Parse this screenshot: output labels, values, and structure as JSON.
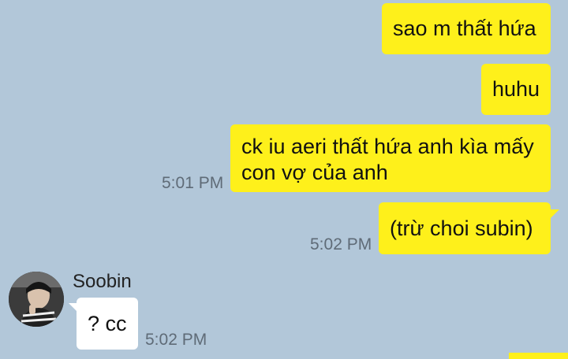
{
  "theme": {
    "background": "#b2c7d9",
    "outgoing_bubble": "#fef01b",
    "incoming_bubble": "#ffffff",
    "time_color": "#5f6b77"
  },
  "messages": [
    {
      "direction": "out",
      "text": "sao m thất hứa",
      "time": ""
    },
    {
      "direction": "out",
      "text": "huhu",
      "time": ""
    },
    {
      "direction": "out",
      "text_lines": [
        "ck iu aeri thất hứa anh kìa mấy",
        "con vợ của anh"
      ],
      "time": "5:01 PM"
    },
    {
      "direction": "out",
      "text": "(trừ choi subin)",
      "time": "5:02 PM"
    }
  ],
  "incoming": {
    "sender": "Soobin",
    "avatar_icon": "profile-photo",
    "text": "? cc",
    "time": "5:02 PM"
  }
}
